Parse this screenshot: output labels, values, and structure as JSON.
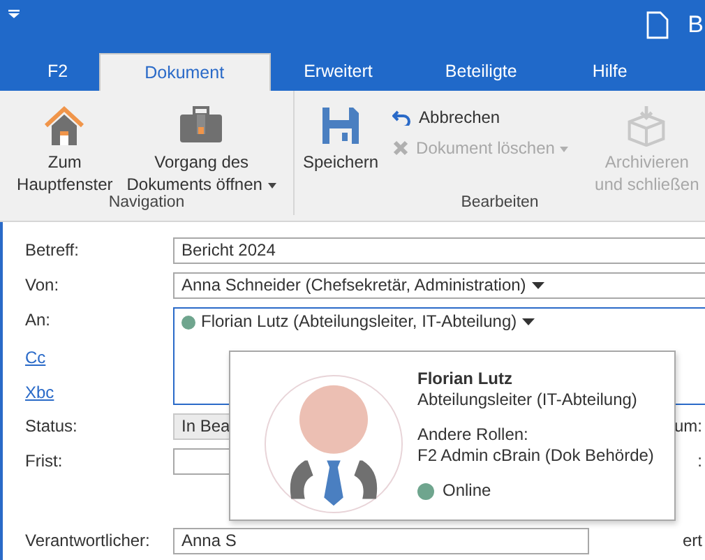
{
  "title_bar": {
    "title": "B"
  },
  "tabs": [
    {
      "label": "F2",
      "selected": false
    },
    {
      "label": "Dokument",
      "selected": true
    },
    {
      "label": "Erweitert",
      "selected": false
    },
    {
      "label": "Beteiligte",
      "selected": false
    },
    {
      "label": "Hilfe",
      "selected": false
    }
  ],
  "ribbon": {
    "groups": [
      {
        "label": "Navigation",
        "buttons": [
          {
            "kind": "large",
            "label": "Zum\nHauptfenster",
            "dropdown": false,
            "disabled": false
          },
          {
            "kind": "large",
            "label": "Vorgang des\nDokuments öffnen",
            "dropdown": true,
            "disabled": false
          }
        ]
      },
      {
        "label": "Bearbeiten",
        "buttons": [
          {
            "kind": "large",
            "label": "Speichern",
            "dropdown": false,
            "disabled": false
          },
          {
            "kind": "small",
            "label": "Abbrechen",
            "dropdown": false,
            "disabled": false
          },
          {
            "kind": "small",
            "label": "Dokument löschen",
            "dropdown": true,
            "disabled": true
          },
          {
            "kind": "large",
            "label": "Archivieren\nund schließen",
            "dropdown": false,
            "disabled": true
          }
        ]
      }
    ]
  },
  "form": {
    "rows": [
      {
        "kind": "text",
        "label": "Betreff:",
        "value": "Bericht 2024"
      },
      {
        "kind": "dropdown",
        "label": "Von:",
        "value": "Anna Schneider (Chefsekretär, Administration)"
      },
      {
        "kind": "recipients",
        "label": "An:",
        "links": [
          "Cc",
          "Xbc"
        ],
        "recipients": [
          {
            "name": "Florian Lutz (Abteilungsleiter, IT-Abteilung)",
            "color": "#6fa58e"
          }
        ]
      },
      {
        "kind": "readonly",
        "label": "Status:",
        "value": "In Bea",
        "right_label": "um:"
      },
      {
        "kind": "text",
        "label": "Frist:",
        "right_label": ":"
      },
      {
        "kind": "spacer"
      },
      {
        "kind": "dropdown",
        "label": "Verantwortlicher:",
        "value": "Anna S",
        "right_label": "ert",
        "caret": false
      }
    ]
  },
  "popup": {
    "name": "Florian Lutz",
    "role": "Abteilungsleiter (IT-Abteilung)",
    "other_roles_label": "Andere Rollen:",
    "other_roles": "F2 Admin cBrain (Dok Behörde)",
    "status": {
      "label": "Online",
      "color": "#6fa58e"
    }
  }
}
